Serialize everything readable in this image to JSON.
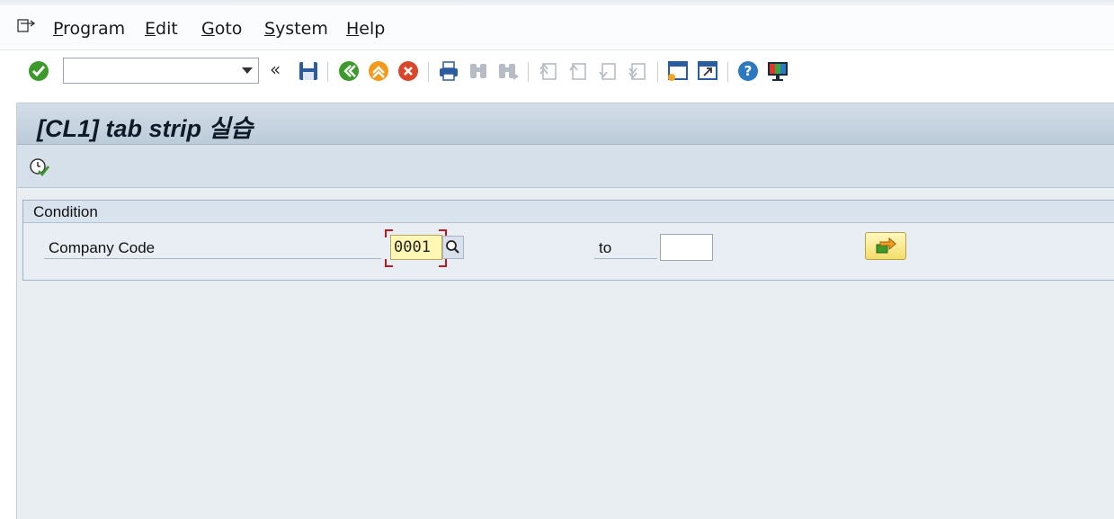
{
  "menu": {
    "items": [
      {
        "u": "P",
        "rest": "rogram"
      },
      {
        "u": "E",
        "rest": "dit"
      },
      {
        "u": "G",
        "rest": "oto"
      },
      {
        "u": "S",
        "rest": "ystem"
      },
      {
        "u": "H",
        "rest": "elp"
      }
    ]
  },
  "toolbar": {
    "command_value": "",
    "icons": [
      "enter-icon",
      "save-icon",
      "back-icon",
      "exit-icon",
      "cancel-icon",
      "print-icon",
      "find-icon",
      "find-next-icon",
      "first-page-icon",
      "previous-page-icon",
      "next-page-icon",
      "last-page-icon",
      "create-session-icon",
      "create-shortcut-icon",
      "help-icon",
      "customize-layout-icon"
    ]
  },
  "screen": {
    "title": "[CL1] tab strip 실습"
  },
  "condition": {
    "title": "Condition",
    "company_code_label": "Company Code",
    "company_code_from": "0001",
    "to_label": "to",
    "company_code_to": ""
  },
  "colors": {
    "accent_green": "#3c9a2a",
    "field_yellow": "#fff8b5",
    "exit_orange": "#f39a1b",
    "cancel_red": "#d9472b",
    "help_blue": "#2c79c0"
  }
}
